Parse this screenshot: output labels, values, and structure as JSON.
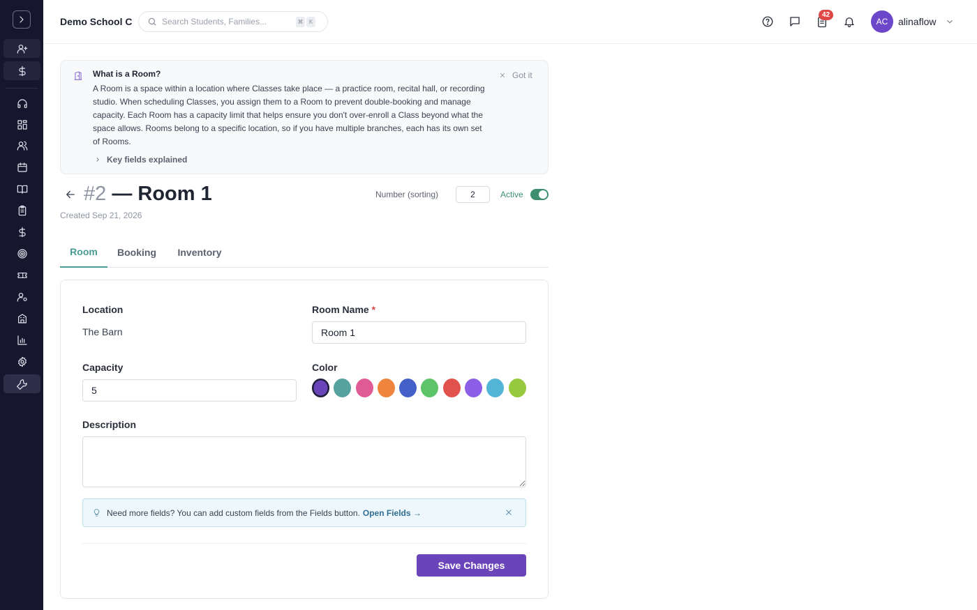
{
  "header": {
    "school_name": "Demo School C",
    "search_placeholder": "Search Students, Families...",
    "search_kbd": [
      "⌘",
      "K"
    ],
    "notification_count": "42",
    "avatar_initials": "AC",
    "username": "alinaflow"
  },
  "sidebar": {
    "icons": [
      "add-user-icon",
      "dollar-icon",
      "headset-icon",
      "dashboard-icon",
      "users-icon",
      "calendar-icon",
      "book-icon",
      "clipboard-icon",
      "dollar-icon",
      "target-icon",
      "ticket-icon",
      "user-settings-icon",
      "building-icon",
      "bar-chart-icon",
      "gear-icon",
      "wrench-icon"
    ]
  },
  "info": {
    "title": "What is a Room?",
    "body": "A Room is a space within a location where Classes take place — a practice room, recital hall, or recording studio. When scheduling Classes, you assign them to a Room to prevent double-booking and manage capacity. Each Room has a capacity limit that helps ensure you don't over-enroll a Class beyond what the space allows. Rooms belong to a specific location, so if you have multiple branches, each has its own set of Rooms.",
    "dismiss_label": "Got it",
    "key_fields_label": "Key fields explained"
  },
  "room": {
    "number_prefix": "#2",
    "title_suffix": "— Room 1",
    "created": "Created Sep 21, 2026",
    "number_label": "Number (sorting)",
    "number_value": "2",
    "active_label": "Active",
    "active": true
  },
  "tabs": [
    {
      "label": "Room",
      "active": true
    },
    {
      "label": "Booking",
      "active": false
    },
    {
      "label": "Inventory",
      "active": false
    }
  ],
  "form": {
    "location_label": "Location",
    "location_value": "The Barn",
    "room_name_label": "Room Name",
    "required_mark": "*",
    "room_name_value": "Room 1",
    "capacity_label": "Capacity",
    "capacity_value": "5",
    "color_label": "Color",
    "colors": [
      "#6a45b9",
      "#55a29f",
      "#e05a95",
      "#ef843c",
      "#4560c8",
      "#5ec46a",
      "#e2524d",
      "#8c5ee8",
      "#52b5d8",
      "#97c93e"
    ],
    "selected_color_index": 0,
    "description_label": "Description",
    "description_value": "",
    "hint_text": "Need more fields? You can add custom fields from the Fields button.",
    "hint_link": "Open Fields →",
    "save_label": "Save Changes"
  }
}
